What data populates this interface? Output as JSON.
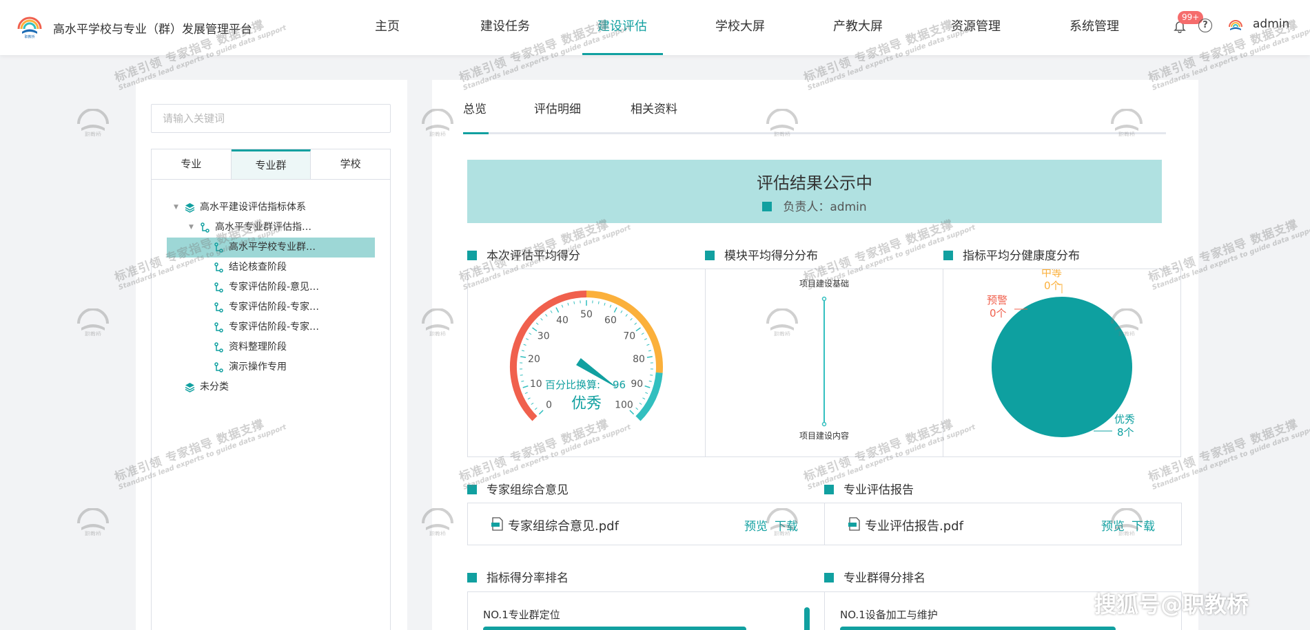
{
  "header": {
    "app_title": "高水平学校与专业（群）发展管理平台",
    "nav": [
      "主页",
      "建设任务",
      "建设评估",
      "学校大屏",
      "产教大屏",
      "资源管理",
      "系统管理"
    ],
    "active_nav": "建设评估",
    "notification_badge": "99+",
    "help_icon": "?",
    "username": "admin",
    "accent_color": "#11a0a0"
  },
  "left": {
    "search_placeholder": "请输入关键词",
    "tabs": [
      "专业",
      "专业群",
      "学校"
    ],
    "active_tab": "专业群",
    "tree": {
      "root": "高水平建设评估指标体系",
      "child": "高水平专业群评估指…",
      "selected": "高水平学校专业群…",
      "items": [
        "结论核查阶段",
        "专家评估阶段-意见…",
        "专家评估阶段-专家…",
        "专家评估阶段-专家…",
        "资料整理阶段",
        "演示操作专用"
      ],
      "uncategorized": "未分类"
    }
  },
  "right": {
    "tabs": [
      "总览",
      "评估明细",
      "相关资料"
    ],
    "active_tab": "总览",
    "banner_title": "评估结果公示中",
    "banner_owner": "负责人：admin",
    "sections": {
      "avg_score": "本次评估平均得分",
      "module_dist": "模块平均得分分布",
      "health_dist": "指标平均分健康度分布",
      "expert_opinion": "专家组综合意见",
      "major_report": "专业评估报告",
      "indicator_rank": "指标得分率排名",
      "group_rank": "专业群得分排名"
    },
    "gauge": {
      "ticks": [
        "0",
        "10",
        "20",
        "30",
        "40",
        "50",
        "60",
        "70",
        "80",
        "90",
        "100"
      ],
      "value": 96,
      "value_label": "百分比换算:",
      "value_text": "96",
      "grade": "优秀",
      "colors": [
        "#f0604d",
        "#fbb03b",
        "#32bfbf"
      ]
    },
    "module_chart": {
      "top_label": "项目建设基础",
      "bottom_label": "项目建设内容"
    },
    "health_chart": {
      "slices": [
        {
          "name": "中等",
          "count": "0个",
          "color": "#fbb03b",
          "value": 0
        },
        {
          "name": "预警",
          "count": "0个",
          "color": "#f0604d",
          "value": 0
        },
        {
          "name": "优秀",
          "count": "8个",
          "color": "#0ea0a0",
          "value": 8
        }
      ]
    },
    "docs": [
      {
        "name": "专家组综合意见.pdf",
        "preview": "预览",
        "download": "下载"
      },
      {
        "name": "专业评估报告.pdf",
        "preview": "预览",
        "download": "下载"
      }
    ],
    "rank": {
      "indicator_first": "NO.1专业群定位",
      "group_first": "NO.1设备加工与维护"
    }
  },
  "watermark": {
    "main": "标准引领 专家指导 数据支撑",
    "en": "Standards lead experts to guide data support",
    "brand": "职教桥"
  },
  "corner_text": "搜狐号@职教桥"
}
